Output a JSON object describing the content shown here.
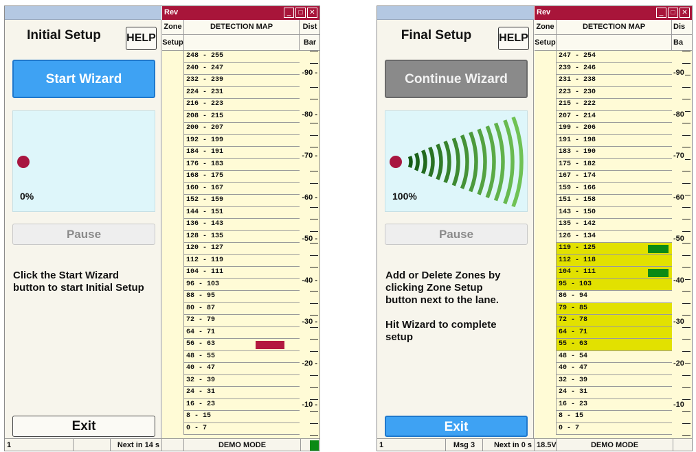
{
  "left": {
    "title": "Initial Setup",
    "help_label": "HELP",
    "wizard_label": "Start Wizard",
    "radar_percent": "0%",
    "radar_progress": 0,
    "pause_label": "Pause",
    "instructions": "Click the Start Wizard\nbutton to start Initial Setup",
    "exit_label": "Exit",
    "window_title": "Rev",
    "header": {
      "zone": "Zone",
      "setup": "Setup",
      "detection_map": "DETECTION MAP",
      "dist": "Dist",
      "bar": "Bar"
    },
    "ranges": [
      "248 - 255",
      "240 - 247",
      "232 - 239",
      "224 - 231",
      "216 - 223",
      "208 - 215",
      "200 - 207",
      "192 - 199",
      "184 - 191",
      "176 - 183",
      "168 - 175",
      "160 - 167",
      "152 - 159",
      "144 - 151",
      "136 - 143",
      "128 - 135",
      "120 - 127",
      "112 - 119",
      "104 - 111",
      "96 - 103",
      "88 - 95",
      "80 - 87",
      "72 - 79",
      "64 - 71",
      "56 - 63",
      "48 - 55",
      "40 - 47",
      "32 - 39",
      "24 - 31",
      "16 - 23",
      "8 - 15",
      "0 - 7"
    ],
    "active_rows": [],
    "markers": [
      {
        "row": 24,
        "color": "#b3183f"
      }
    ],
    "scale_labels": [
      "-90 -",
      "-80 -",
      "-70 -",
      "-60 -",
      "-50 -",
      "-40 -",
      "-30 -",
      "-20 -",
      "-10 -"
    ],
    "status": {
      "s1": "1",
      "s2": "",
      "s3": "Next in 14 s",
      "s4": "",
      "s5": "DEMO MODE",
      "indicator_color": "#0a8a14"
    }
  },
  "right": {
    "title": "Final Setup",
    "help_label": "HELP",
    "wizard_label": "Continue Wizard",
    "radar_percent": "100%",
    "radar_progress": 1,
    "pause_label": "Pause",
    "instructions": "Add or Delete Zones by\nclicking Zone Setup\nbutton next to the lane.\n\nHit Wizard to complete\nsetup",
    "exit_label": "Exit",
    "window_title": "Rev",
    "header": {
      "zone": "Zone",
      "setup": "Setup",
      "detection_map": "DETECTION MAP",
      "dist": "Dis",
      "bar": "Ba"
    },
    "ranges": [
      "247 - 254",
      "239 - 246",
      "231 - 238",
      "223 - 230",
      "215 - 222",
      "207 - 214",
      "199 - 206",
      "191 - 198",
      "183 - 190",
      "175 - 182",
      "167 - 174",
      "159 - 166",
      "151 - 158",
      "143 - 150",
      "135 - 142",
      "126 - 134",
      "119 - 125",
      "112 - 118",
      "104 - 111",
      "95 - 103",
      "86 - 94",
      "79 - 85",
      "72 - 78",
      "64 - 71",
      "55 - 63",
      "48 - 54",
      "40 - 47",
      "32 - 39",
      "24 - 31",
      "16 - 23",
      "8 - 15",
      "0 - 7"
    ],
    "active_rows": [
      16,
      17,
      18,
      19,
      21,
      22,
      23,
      24
    ],
    "markers": [
      {
        "row": 16,
        "color": "#0a8a14"
      },
      {
        "row": 18,
        "color": "#0a8a14"
      }
    ],
    "scale_labels": [
      "-90",
      "-80",
      "-70",
      "-60",
      "-50",
      "-40",
      "-30",
      "-20",
      "-10"
    ],
    "status": {
      "s1": "1",
      "s2": "Msg 3",
      "s3": "Next in 0 s",
      "s4": "18.5V",
      "s5": "DEMO MODE",
      "indicator_color": ""
    }
  }
}
